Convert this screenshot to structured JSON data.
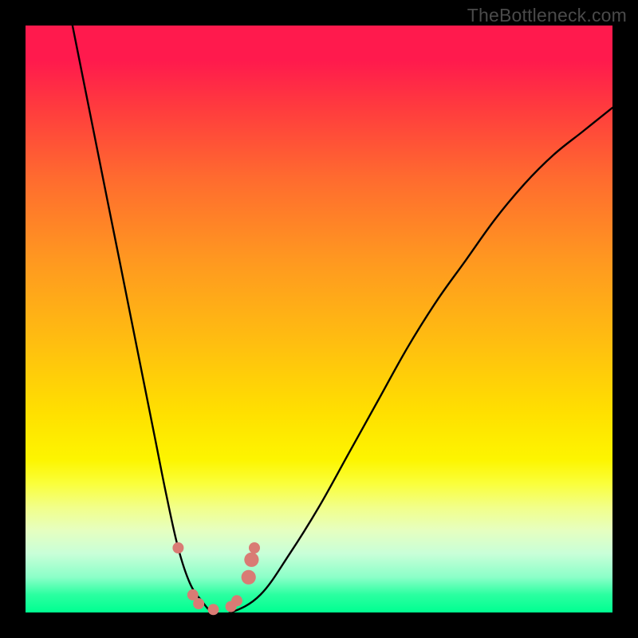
{
  "watermark": "TheBottleneck.com",
  "colors": {
    "background": "#000000",
    "gradient_top": "#ff1a4d",
    "gradient_mid": "#ffe000",
    "gradient_bottom": "#00ff91",
    "curve": "#000000",
    "marker": "#d97b74"
  },
  "chart_data": {
    "type": "line",
    "title": "",
    "xlabel": "",
    "ylabel": "",
    "xlim": [
      0,
      100
    ],
    "ylim": [
      0,
      100
    ],
    "grid": false,
    "legend": false,
    "annotations": [
      "TheBottleneck.com"
    ],
    "series": [
      {
        "name": "bottleneck-curve",
        "x": [
          8,
          10,
          12,
          14,
          16,
          18,
          20,
          22,
          24,
          26,
          28,
          30,
          32,
          35,
          40,
          45,
          50,
          55,
          60,
          65,
          70,
          75,
          80,
          85,
          90,
          95,
          100
        ],
        "y": [
          100,
          90,
          80,
          70,
          60,
          50,
          40,
          30,
          20,
          11,
          5,
          2,
          0,
          0,
          3,
          10,
          18,
          27,
          36,
          45,
          53,
          60,
          67,
          73,
          78,
          82,
          86
        ]
      }
    ],
    "markers": [
      {
        "x": 26,
        "y": 11,
        "r": 1.0
      },
      {
        "x": 28.5,
        "y": 3,
        "r": 1.0
      },
      {
        "x": 29.5,
        "y": 1.5,
        "r": 1.0
      },
      {
        "x": 32,
        "y": 0.5,
        "r": 1.0
      },
      {
        "x": 35,
        "y": 1,
        "r": 1.0
      },
      {
        "x": 36,
        "y": 2,
        "r": 1.0
      },
      {
        "x": 38,
        "y": 6,
        "r": 1.3
      },
      {
        "x": 38.5,
        "y": 9,
        "r": 1.3
      },
      {
        "x": 39,
        "y": 11,
        "r": 1.0
      }
    ]
  }
}
